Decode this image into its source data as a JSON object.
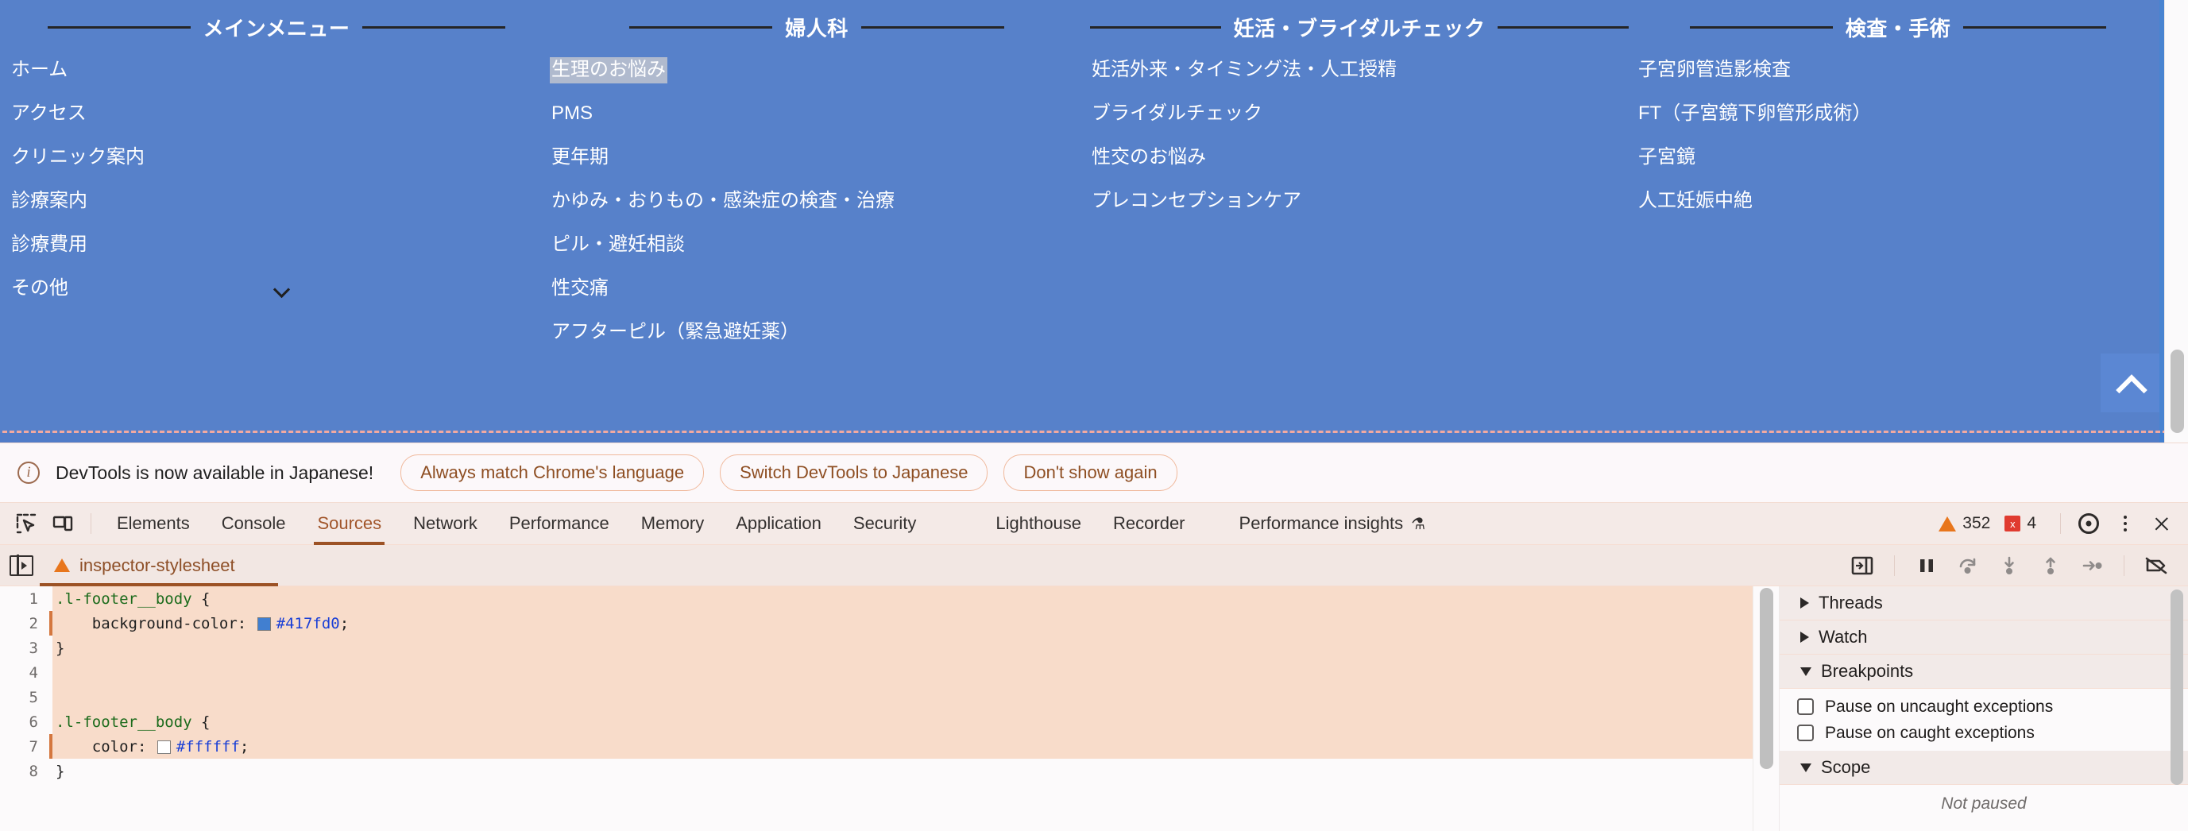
{
  "page": {
    "footer": {
      "background_color": "#517cc8",
      "text_color": "#ffffff",
      "columns": [
        {
          "title": "メインメニュー",
          "items": [
            {
              "label": "ホーム"
            },
            {
              "label": "アクセス"
            },
            {
              "label": "クリニック案内"
            },
            {
              "label": "診療案内"
            },
            {
              "label": "診療費用"
            },
            {
              "label": "その他",
              "has_chevron": true
            }
          ]
        },
        {
          "title": "婦人科",
          "items": [
            {
              "label": "生理のお悩み",
              "selected": true
            },
            {
              "label": "PMS"
            },
            {
              "label": "更年期"
            },
            {
              "label": "かゆみ・おりもの・感染症の検査・治療"
            },
            {
              "label": "ピル・避妊相談"
            },
            {
              "label": "性交痛"
            },
            {
              "label": "アフターピル（緊急避妊薬）"
            }
          ]
        },
        {
          "title": "妊活・ブライダルチェック",
          "items": [
            {
              "label": "妊活外来・タイミング法・人工授精"
            },
            {
              "label": "ブライダルチェック"
            },
            {
              "label": "性交のお悩み"
            },
            {
              "label": "プレコンセプションケア"
            }
          ]
        },
        {
          "title": "検査・手術",
          "items": [
            {
              "label": "子宮卵管造影検査"
            },
            {
              "label": "FT（子宮鏡下卵管形成術）"
            },
            {
              "label": "子宮鏡"
            },
            {
              "label": "人工妊娠中絶"
            }
          ]
        }
      ],
      "scroll_to_top": {
        "icon": "chevron-up-icon"
      }
    }
  },
  "devtools": {
    "notice": {
      "icon": "info-icon",
      "text": "DevTools is now available in Japanese!",
      "buttons": [
        "Always match Chrome's language",
        "Switch DevTools to Japanese",
        "Don't show again"
      ],
      "close_icon": "close-icon"
    },
    "tabbar": {
      "left_icons": [
        "inspect-element-icon",
        "device-toolbar-icon"
      ],
      "tabs": [
        {
          "label": "Elements",
          "active": false
        },
        {
          "label": "Console",
          "active": false
        },
        {
          "label": "Sources",
          "active": true
        },
        {
          "label": "Network",
          "active": false
        },
        {
          "label": "Performance",
          "active": false
        },
        {
          "label": "Memory",
          "active": false
        },
        {
          "label": "Application",
          "active": false
        },
        {
          "label": "Security",
          "active": false
        },
        {
          "label": "Lighthouse",
          "active": false
        },
        {
          "label": "Recorder",
          "active": false
        },
        {
          "label": "Performance insights",
          "active": false,
          "flask": "⚗"
        }
      ],
      "warning_count": "352",
      "error_count": "4",
      "error_badge_glyph": "x",
      "settings_icon": "gear-icon",
      "more_icon": "kebab-menu-icon",
      "close_icon": "close-icon"
    },
    "sources": {
      "panel_toggle_icon": "show-navigator-icon",
      "file_tab": {
        "name": "inspector-stylesheet",
        "warning_icon": "warning-triangle-icon",
        "close_icon": "close-icon"
      },
      "debug_buttons": [
        "show-debugger-sidebar-icon",
        "pause-script-icon",
        "step-over-icon",
        "step-into-icon",
        "step-out-icon",
        "step-icon",
        "deactivate-breakpoints-icon"
      ],
      "code_lines": [
        {
          "n": "1",
          "highlight": true,
          "exec": false,
          "tokens": [
            {
              "t": ".l-footer__body ",
              "c": "sel"
            },
            {
              "t": "{",
              "c": "punct"
            }
          ]
        },
        {
          "n": "2",
          "highlight": true,
          "exec": true,
          "tokens": [
            {
              "t": "    background-color: ",
              "c": "prop"
            },
            {
              "t": "#417fd0",
              "c": "val",
              "swatch": "#417fd0"
            },
            {
              "t": ";",
              "c": "punct"
            }
          ]
        },
        {
          "n": "3",
          "highlight": true,
          "exec": false,
          "tokens": [
            {
              "t": "}",
              "c": "punct"
            }
          ]
        },
        {
          "n": "4",
          "highlight": true,
          "exec": false,
          "tokens": [
            {
              "t": "",
              "c": "punct"
            }
          ]
        },
        {
          "n": "5",
          "highlight": true,
          "exec": false,
          "tokens": [
            {
              "t": "",
              "c": "punct"
            }
          ]
        },
        {
          "n": "6",
          "highlight": true,
          "exec": false,
          "tokens": [
            {
              "t": ".l-footer__body ",
              "c": "sel"
            },
            {
              "t": "{",
              "c": "punct"
            }
          ]
        },
        {
          "n": "7",
          "highlight": true,
          "exec": true,
          "tokens": [
            {
              "t": "    color: ",
              "c": "prop"
            },
            {
              "t": "#ffffff",
              "c": "val",
              "swatch": "#ffffff"
            },
            {
              "t": ";",
              "c": "punct"
            }
          ]
        },
        {
          "n": "8",
          "highlight": false,
          "exec": false,
          "tokens": [
            {
              "t": "}",
              "c": "punct"
            }
          ]
        }
      ],
      "sidebar": {
        "sections": [
          {
            "label": "Threads",
            "expanded": false
          },
          {
            "label": "Watch",
            "expanded": false
          },
          {
            "label": "Breakpoints",
            "expanded": true
          },
          {
            "label": "Scope",
            "expanded": true
          }
        ],
        "breakpoint_options": [
          {
            "label": "Pause on uncaught exceptions",
            "checked": false
          },
          {
            "label": "Pause on caught exceptions",
            "checked": false
          }
        ],
        "scope_status": "Not paused"
      }
    }
  }
}
